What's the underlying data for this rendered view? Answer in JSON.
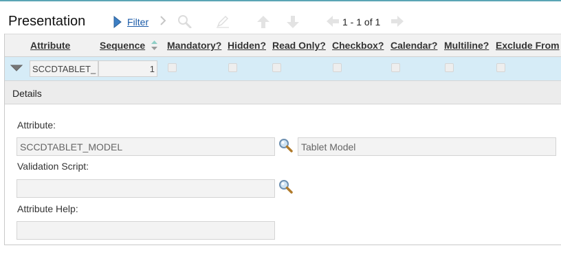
{
  "header": {
    "title": "Presentation"
  },
  "toolbar": {
    "filter_label": "Filter",
    "record_counter": "1 - 1 of 1"
  },
  "grid": {
    "columns": [
      "Attribute",
      "Sequence",
      "Mandatory?",
      "Hidden?",
      "Read Only?",
      "Checkbox?",
      "Calendar?",
      "Multiline?",
      "Exclude From"
    ],
    "row": {
      "attribute": "SCCDTABLET_",
      "sequence": "1"
    }
  },
  "details": {
    "title": "Details",
    "attribute_label": "Attribute:",
    "attribute_value": "SCCDTABLET_MODEL",
    "attribute_description": "Tablet Model",
    "validation_script_label": "Validation Script:",
    "validation_script_value": "",
    "attribute_help_label": "Attribute Help:",
    "attribute_help_value": ""
  }
}
